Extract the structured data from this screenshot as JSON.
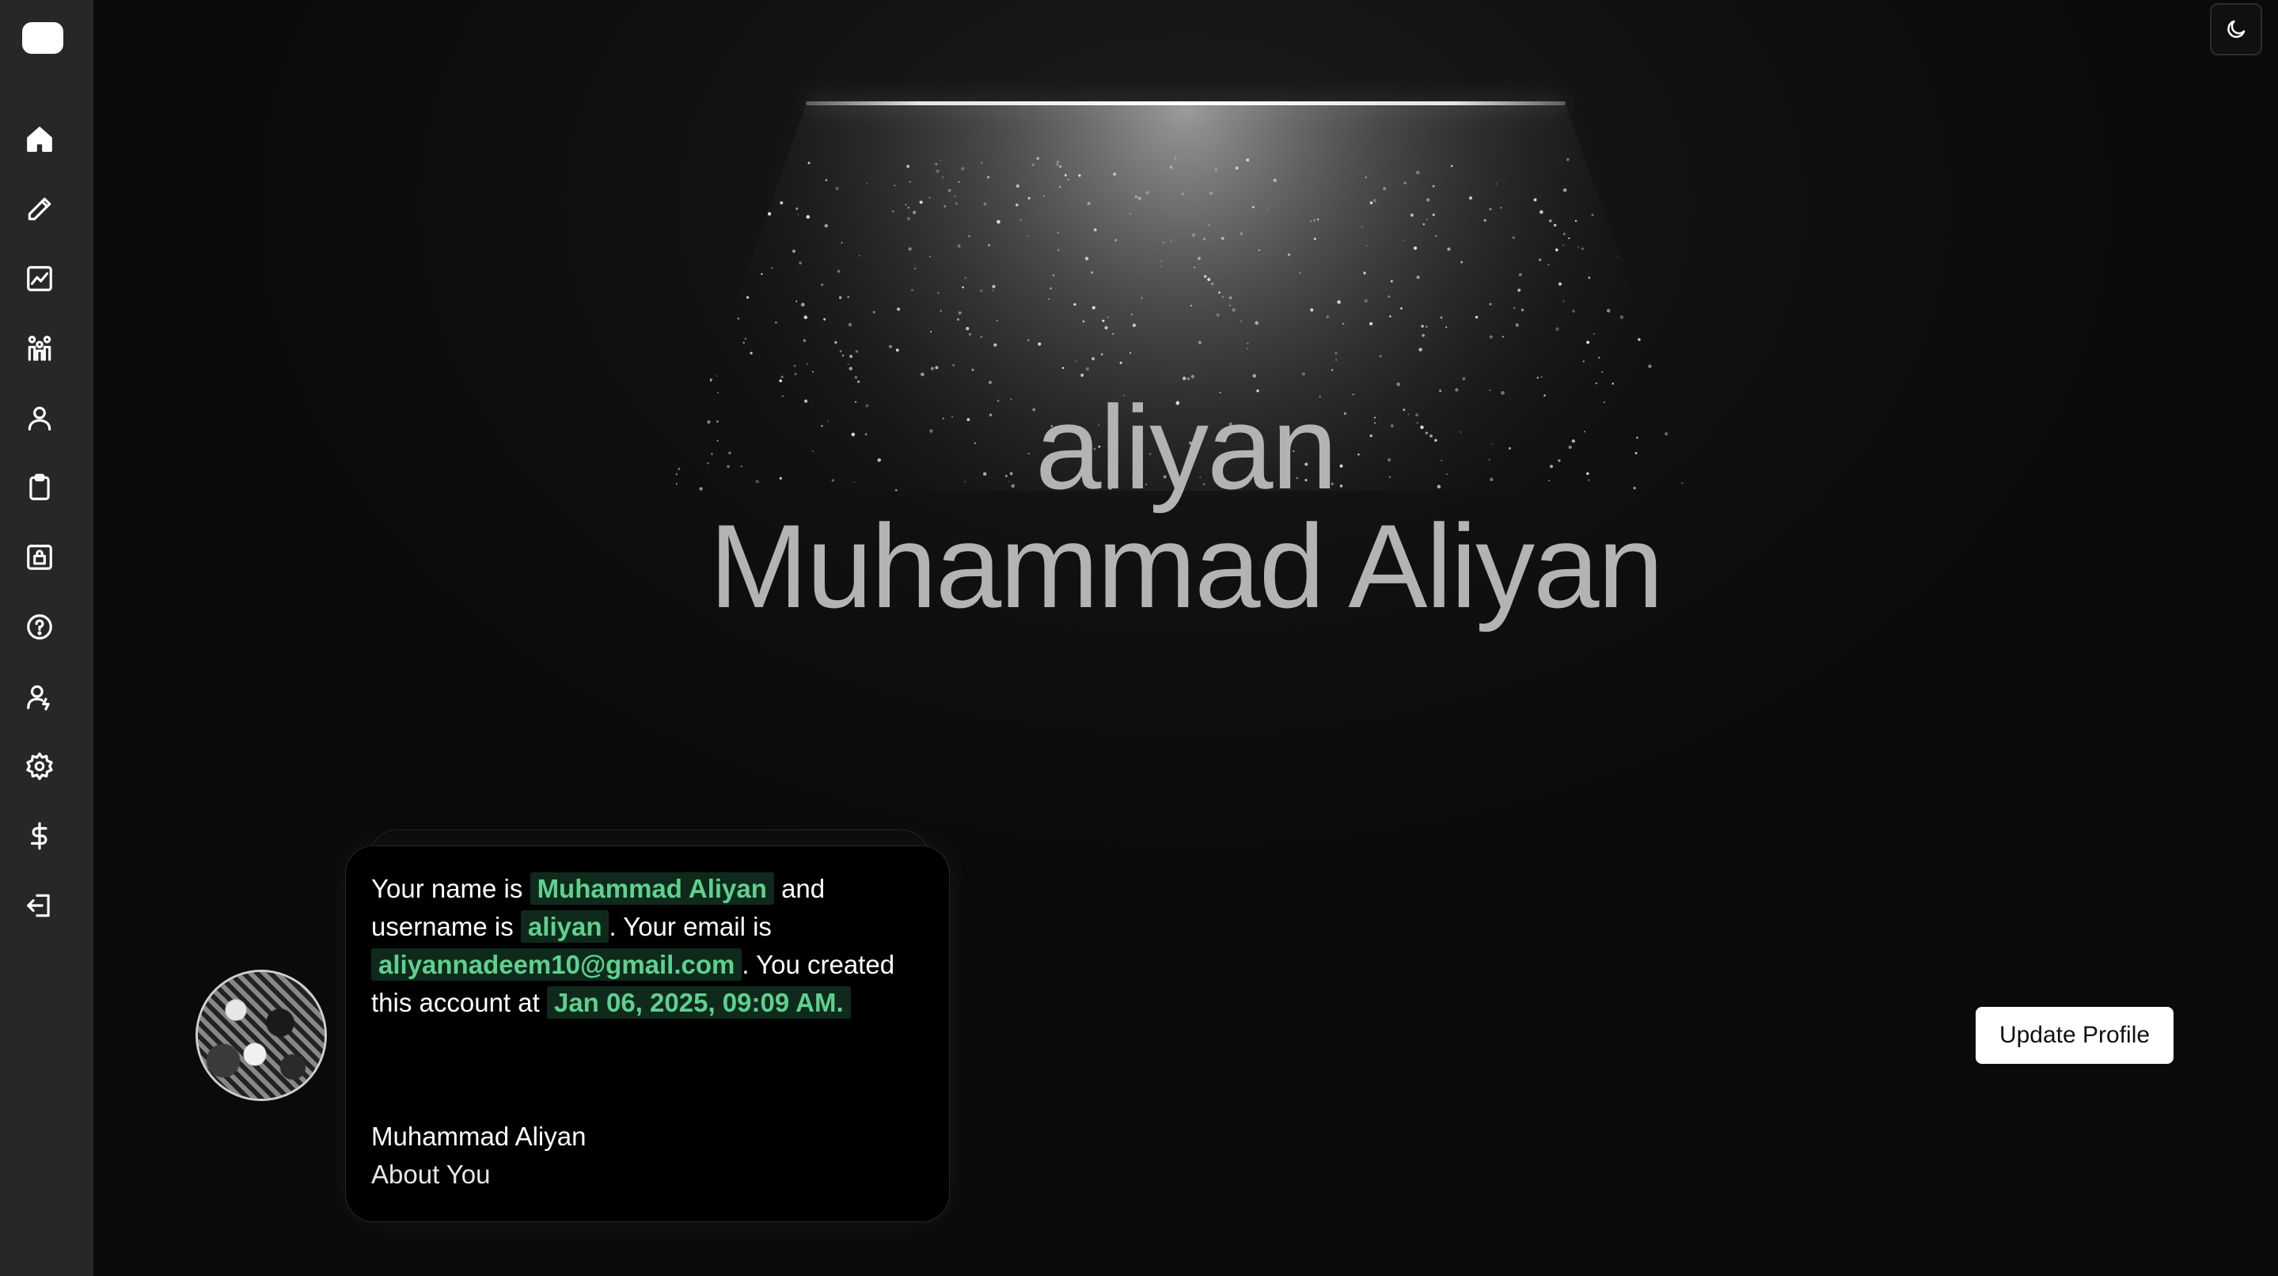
{
  "sidebar": {
    "items": [
      {
        "icon": "home-icon"
      },
      {
        "icon": "pencil-icon"
      },
      {
        "icon": "chart-icon"
      },
      {
        "icon": "users-icon"
      },
      {
        "icon": "user-icon"
      },
      {
        "icon": "clipboard-icon"
      },
      {
        "icon": "lock-icon"
      },
      {
        "icon": "help-icon"
      },
      {
        "icon": "user-edit-icon"
      },
      {
        "icon": "gear-icon"
      },
      {
        "icon": "dollar-icon"
      },
      {
        "icon": "logout-icon"
      }
    ]
  },
  "header": {
    "theme_toggle_icon": "moon-icon"
  },
  "hero": {
    "username": "aliyan",
    "full_name": "Muhammad Aliyan"
  },
  "card": {
    "text_1": "Your name is ",
    "name_value": "Muhammad Aliyan",
    "text_2": " and username is ",
    "username_value": "aliyan",
    "text_3": ". Your email is ",
    "email_value": "aliyannadeem10@gmail.com",
    "text_4": ". You created this account at ",
    "created_value": "Jan 06, 2025, 09:09 AM.",
    "footer_name": "Muhammad Aliyan",
    "footer_about": "About You"
  },
  "actions": {
    "update_profile": "Update Profile"
  },
  "colors": {
    "highlight_text": "#5fd08e",
    "highlight_bg": "#0f2a1c",
    "sidebar_bg": "#272727",
    "page_bg": "#0c0c0c"
  }
}
